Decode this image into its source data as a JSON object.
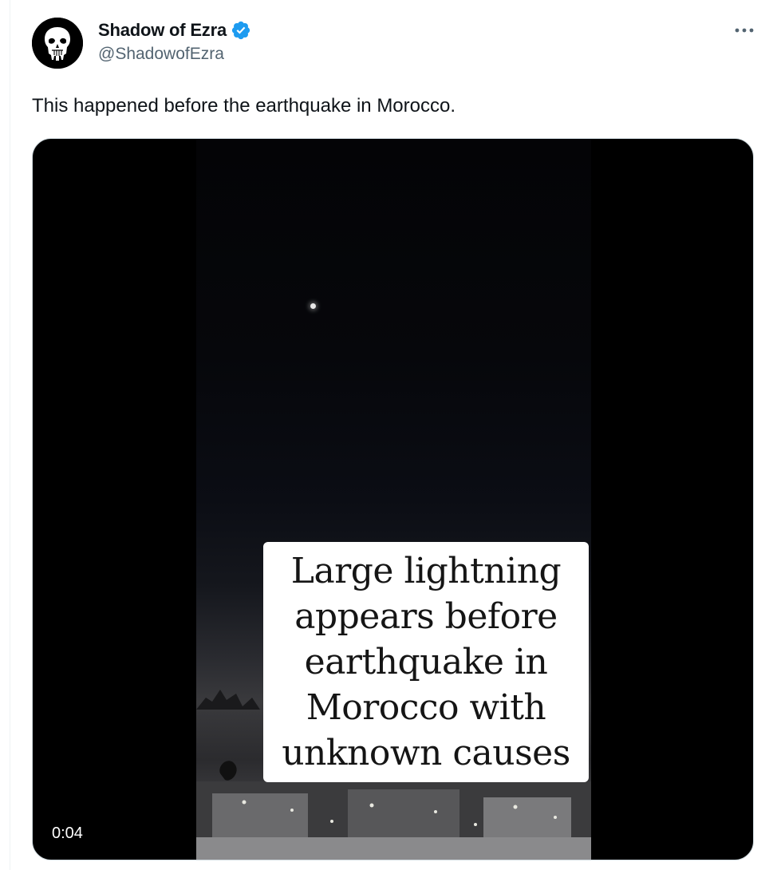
{
  "author": {
    "display_name": "Shadow of Ezra",
    "handle": "@ShadowofEzra",
    "verified": true,
    "avatar_icon": "punisher-skull-icon",
    "verified_color": "#1d9bf0"
  },
  "menu": {
    "icon": "more-horizontal-icon"
  },
  "tweet": {
    "text": "This happened before the earthquake in Morocco."
  },
  "media": {
    "type": "video",
    "caption_overlay": "Large lightning\nappears before\nearthquake in\nMorocco with\nunknown causes",
    "timestamp": "0:04"
  },
  "colors": {
    "text_primary": "#0f1419",
    "text_secondary": "#536471",
    "border": "#cfd9de"
  }
}
